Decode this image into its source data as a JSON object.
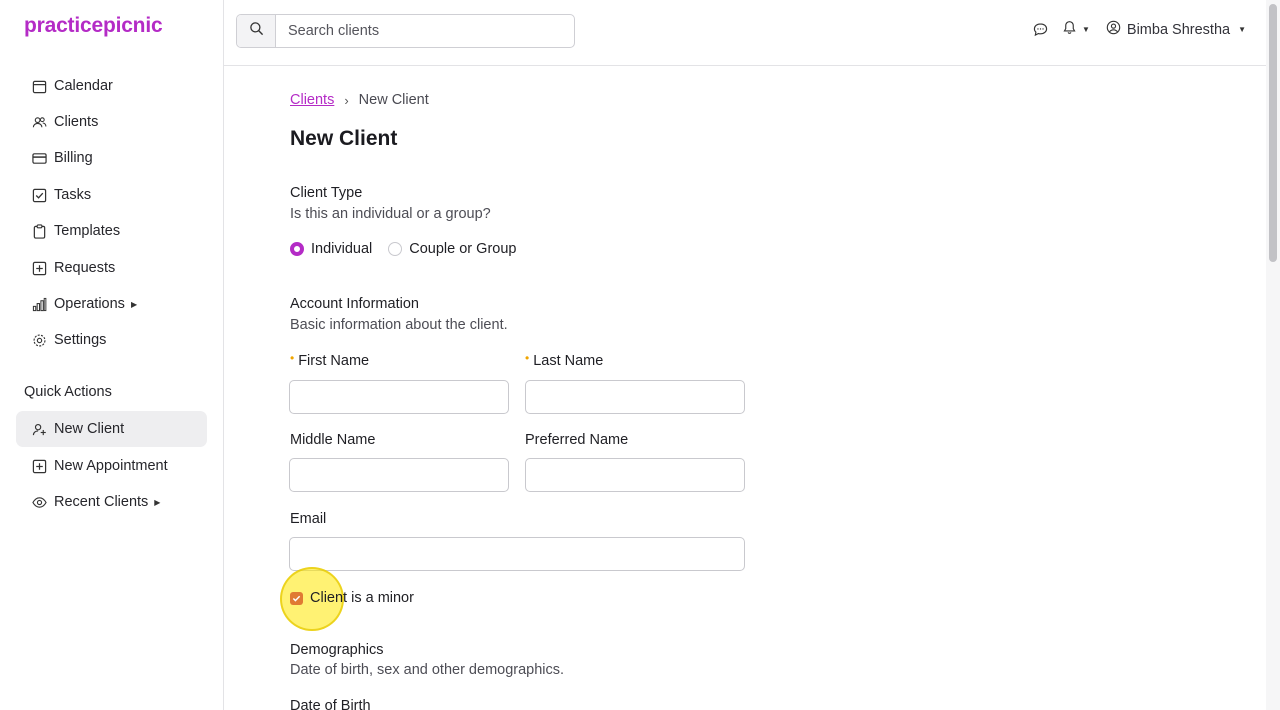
{
  "app": {
    "logo": "practicepicnic",
    "accent": "#b42bc6"
  },
  "sidebar": {
    "items": [
      {
        "label": "Calendar",
        "icon": "calendar-icon"
      },
      {
        "label": "Clients",
        "icon": "users-icon"
      },
      {
        "label": "Billing",
        "icon": "credit-card-icon"
      },
      {
        "label": "Tasks",
        "icon": "checkbox-icon"
      },
      {
        "label": "Templates",
        "icon": "clipboard-icon"
      },
      {
        "label": "Requests",
        "icon": "inbox-plus-icon"
      },
      {
        "label": "Operations",
        "icon": "bar-chart-icon"
      },
      {
        "label": "Settings",
        "icon": "gear-icon"
      }
    ],
    "quick_actions_label": "Quick Actions",
    "quick_actions": [
      {
        "label": "New Client",
        "icon": "user-plus-icon",
        "active": true
      },
      {
        "label": "New Appointment",
        "icon": "calendar-plus-icon"
      },
      {
        "label": "Recent Clients",
        "icon": "eye-icon"
      }
    ]
  },
  "topbar": {
    "search_placeholder": "Search clients",
    "user_name": "Bimba Shrestha"
  },
  "breadcrumb": {
    "parent": "Clients",
    "current": "New Client"
  },
  "page_title": "New Client",
  "client_type": {
    "title": "Client Type",
    "subtitle": "Is this an individual or a group?",
    "options": [
      "Individual",
      "Couple or Group"
    ],
    "selected": "Individual"
  },
  "account": {
    "title": "Account Information",
    "subtitle": "Basic information about the client.",
    "first_name_label": "First Name",
    "last_name_label": "Last Name",
    "middle_name_label": "Middle Name",
    "preferred_name_label": "Preferred Name",
    "email_label": "Email",
    "minor_label": "Client is a minor",
    "minor_checked": true
  },
  "demographics": {
    "title": "Demographics",
    "subtitle": "Date of birth, sex and other demographics.",
    "dob_label": "Date of Birth"
  }
}
